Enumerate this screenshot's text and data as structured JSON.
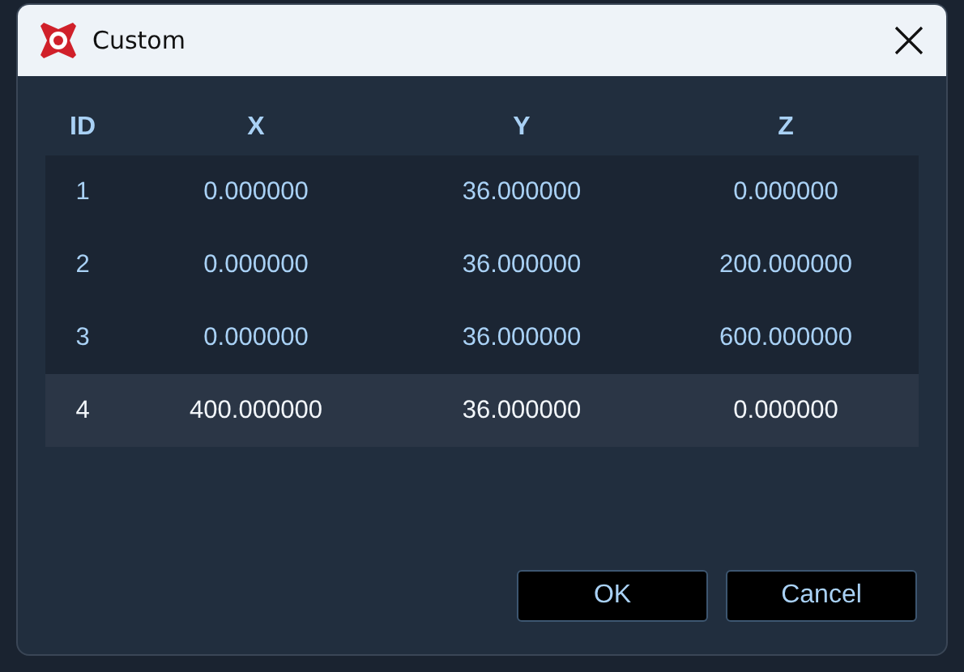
{
  "window": {
    "title": "Custom"
  },
  "table": {
    "columns": [
      "ID",
      "X",
      "Y",
      "Z"
    ],
    "rows": [
      {
        "cells": [
          "1",
          "0.000000",
          "36.000000",
          "0.000000"
        ],
        "selected": false
      },
      {
        "cells": [
          "2",
          "0.000000",
          "36.000000",
          "200.000000"
        ],
        "selected": false
      },
      {
        "cells": [
          "3",
          "0.000000",
          "36.000000",
          "600.000000"
        ],
        "selected": false
      },
      {
        "cells": [
          "4",
          "400.000000",
          "36.000000",
          "0.000000"
        ],
        "selected": true
      }
    ]
  },
  "buttons": [
    "OK",
    "Cancel"
  ]
}
